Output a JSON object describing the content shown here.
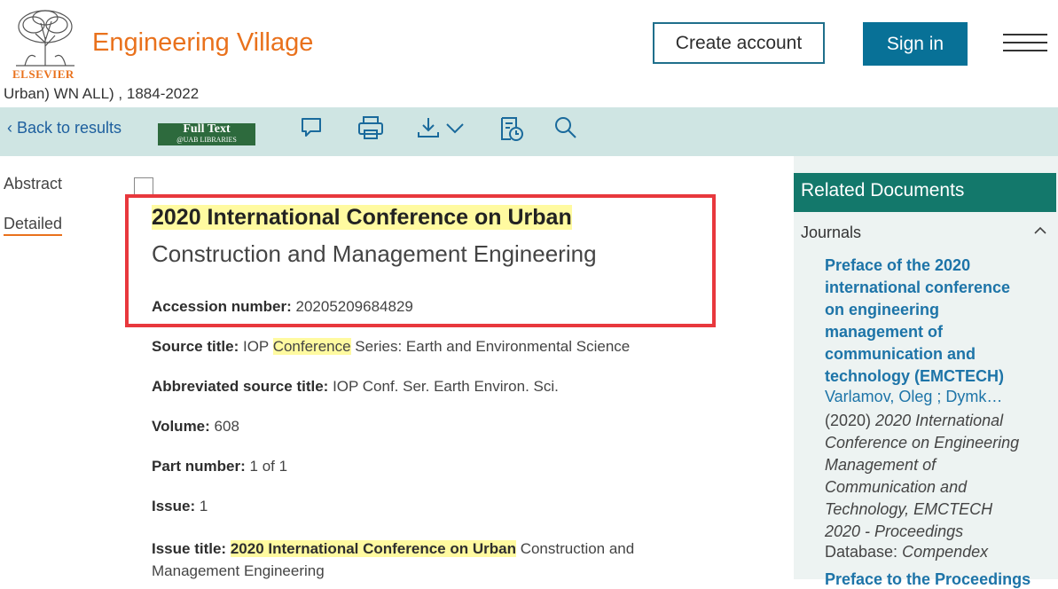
{
  "header": {
    "brand": "Engineering Village",
    "publisher": "ELSEVIER",
    "create_account": "Create account",
    "sign_in": "Sign in",
    "query_line": "Urban) WN ALL) , 1884-2022"
  },
  "toolbar": {
    "back": "Back to results",
    "fulltext_line1": "Full Text",
    "fulltext_line2": "@UAB LIBRARIES",
    "icons": [
      "comment-icon",
      "print-icon",
      "download-icon",
      "chevron-down-icon",
      "history-icon",
      "search-icon"
    ]
  },
  "nav": {
    "abstract": "Abstract",
    "detailed": "Detailed"
  },
  "record": {
    "title_highlight": "2020 International Conference on Urban",
    "title_rest": "Construction and Management Engineering",
    "fields": [
      {
        "label": "Accession number:",
        "value": "20205209684829"
      },
      {
        "label": "Source title:",
        "value_pre": "IOP ",
        "value_hl": "Conference",
        "value_post": " Series: Earth and Environmental Science"
      },
      {
        "label": "Abbreviated source title:",
        "value": "IOP Conf. Ser. Earth Environ. Sci."
      },
      {
        "label": "Volume:",
        "value": "608"
      },
      {
        "label": "Part number:",
        "value": "1 of 1"
      },
      {
        "label": "Issue:",
        "value": "1"
      },
      {
        "label": "Issue title:",
        "value_hl": "2020 International Conference on Urban",
        "value_post": " Construction and",
        "value_line2": "Management Engineering"
      }
    ]
  },
  "related": {
    "header": "Related Documents",
    "section": "Journals",
    "doc1": {
      "title": "Preface of the 2020 international conference on engineering management of communication and technology (EMCTECH)",
      "authors": "Varlamov, Oleg ; Dymk…",
      "year": "(2020)",
      "source": "2020 International Conference on Engineering Management of Communication and Technology, EMCTECH 2020 - Proceedings",
      "db_label": "Database:",
      "db_value": "Compendex"
    },
    "doc2_title": "Preface to the Proceedings"
  },
  "colors": {
    "brand_orange": "#e9711c",
    "primary_blue": "#087197",
    "toolbar_bg": "#cfe5e3",
    "related_header": "#13786b",
    "highlight": "#fffaa0",
    "annotation_red": "#e8383d"
  }
}
